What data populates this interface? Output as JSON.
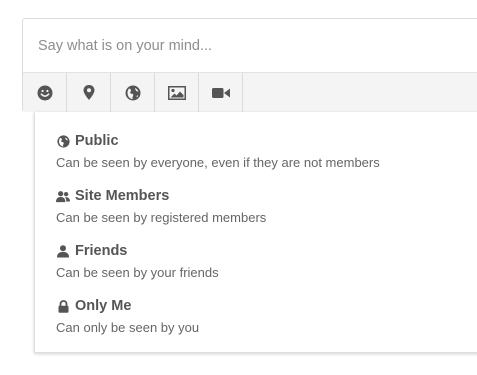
{
  "composer": {
    "placeholder": "Say what is on your mind...",
    "toolbar": [
      {
        "icon": "smiley-icon",
        "label": ""
      },
      {
        "icon": "location-pin-icon",
        "label": ""
      },
      {
        "icon": "globe-icon",
        "label": ""
      },
      {
        "icon": "image-icon",
        "label": ""
      },
      {
        "icon": "video-camera-icon",
        "label": ""
      }
    ]
  },
  "privacy_menu": {
    "options": [
      {
        "icon": "globe-icon",
        "label": "Public",
        "description": "Can be seen by everyone, even if they are not members"
      },
      {
        "icon": "users-icon",
        "label": "Site Members",
        "description": "Can be seen by registered members"
      },
      {
        "icon": "user-icon",
        "label": "Friends",
        "description": "Can be seen by your friends"
      },
      {
        "icon": "lock-icon",
        "label": "Only Me",
        "description": "Can only be seen by you"
      }
    ]
  },
  "colors": {
    "icon": "#555555",
    "toolbar_bg": "#f4f4f4",
    "border": "#dcdcdc",
    "label": "#555555",
    "description": "#666666"
  }
}
